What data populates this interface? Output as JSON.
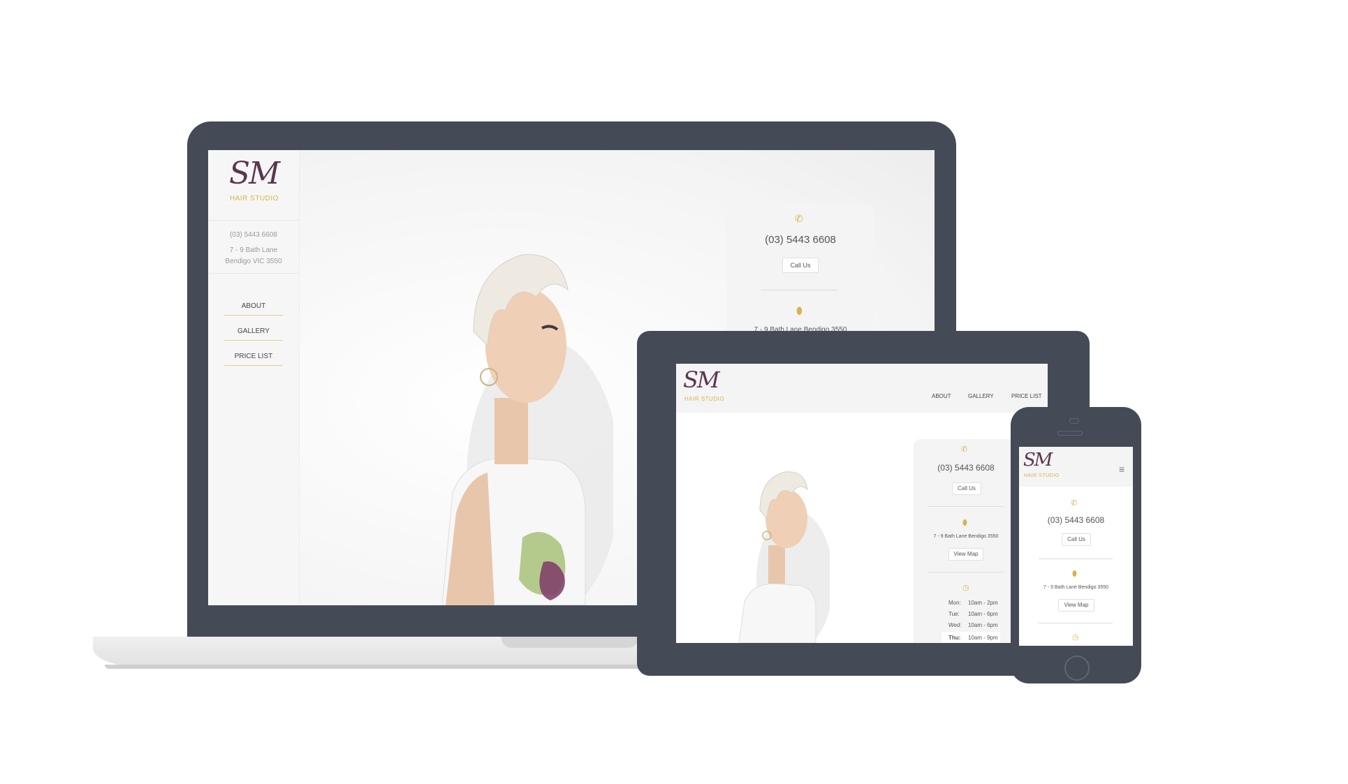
{
  "brand": {
    "logo_text": "SM",
    "logo_sub": "HAIR STUDIO",
    "accent": "#d8b34b",
    "logo_color": "#5a3650",
    "device_color": "#444b56"
  },
  "laptop": {
    "sidebar": {
      "phone": "(03) 5443 6608",
      "address_line1": "7 - 9 Bath Lane",
      "address_line2": "Bendigo VIC 3550",
      "nav": [
        "ABOUT",
        "GALLERY",
        "PRICE LIST"
      ]
    },
    "card": {
      "phone": "(03) 5443 6608",
      "call_button": "Call Us",
      "address": "7 - 9 Bath Lane Bendigo 3550"
    }
  },
  "tablet": {
    "nav": [
      "ABOUT",
      "GALLERY",
      "PRICE LIST"
    ],
    "card": {
      "phone": "(03) 5443 6608",
      "call_button": "Call Us",
      "address": "7 - 9 Bath Lane Bendigo 3550",
      "map_button": "View Map",
      "hours": [
        {
          "day": "Mon:",
          "time": "10am - 2pm"
        },
        {
          "day": "Tue:",
          "time": "10am - 6pm"
        },
        {
          "day": "Wed:",
          "time": "10am - 6pm"
        },
        {
          "day": "Thu:",
          "time": "10am - 9pm"
        }
      ]
    }
  },
  "phone": {
    "card": {
      "phone": "(03) 5443 6608",
      "call_button": "Call Us",
      "address": "7 - 9 Bath Lane Bendigo 3550",
      "map_button": "View Map"
    }
  }
}
